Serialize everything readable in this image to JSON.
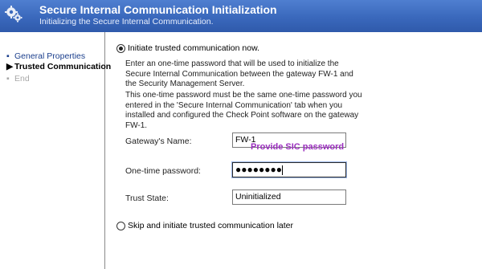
{
  "header": {
    "title": "Secure Internal Communication Initialization",
    "subtitle": "Initializing the Secure Internal Communication.",
    "icon": "gears-icon",
    "color": "#3a68bc"
  },
  "sidebar": {
    "items": [
      {
        "label": "General Properties",
        "state": "done",
        "marker": "▪"
      },
      {
        "label": "Trusted Communication",
        "state": "current",
        "marker": "▶"
      },
      {
        "label": "End",
        "state": "disabled",
        "marker": "▪"
      }
    ]
  },
  "main": {
    "option_initiate": "Initiate trusted communication now.",
    "option_skip": "Skip and initiate trusted communication later",
    "description_1": "Enter an one-time password that will be used to initialize the Secure Internal Communication between the gateway FW-1 and the Security Management Server.",
    "description_2": "This one-time password must be the same one-time password you entered in the 'Secure Internal Communication' tab when you installed and configured the Check Point software on the gateway FW-1.",
    "gateway_label": "Gateway's Name:",
    "gateway_value": "FW-1",
    "password_label": "One-time password:",
    "password_value": "●●●●●●●●",
    "trust_label": "Trust State:",
    "trust_value": "Uninitialized",
    "selected_option": "initiate"
  },
  "annotation": {
    "text": "Provide SIC password",
    "color": "#9b2fbf"
  }
}
